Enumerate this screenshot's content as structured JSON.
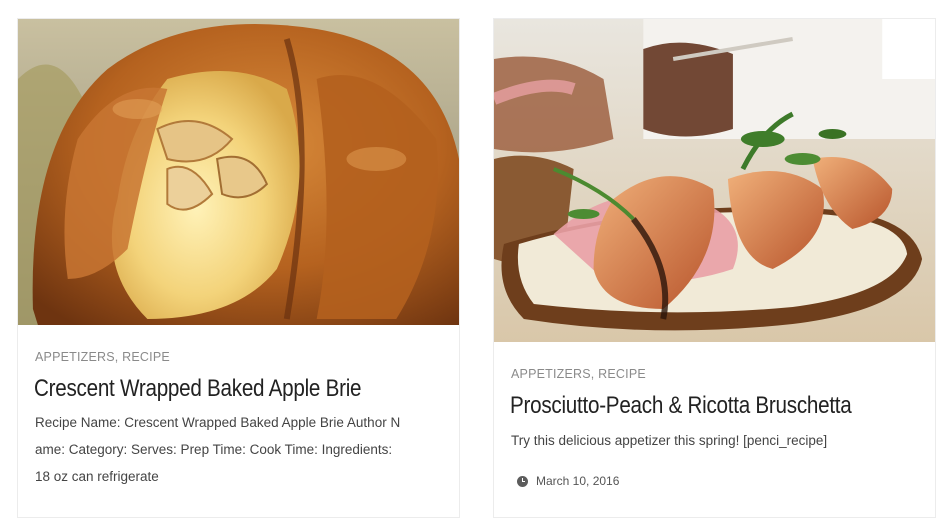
{
  "posts": [
    {
      "image_alt": "Crescent wrapped baked apple brie in golden pastry",
      "categories": [
        "APPETIZERS",
        "RECIPE"
      ],
      "separator": ", ",
      "title": "Crescent Wrapped Baked Apple Brie",
      "excerpt_lines": [
        "Recipe Name: Crescent Wrapped Baked Apple Brie Author N",
        "ame: Category: Serves: Prep Time: Cook Time: Ingredients:",
        "18 oz can refrigerate"
      ]
    },
    {
      "image_alt": "Prosciutto and peach bruschetta with ricotta and arugula",
      "categories": [
        "APPETIZERS",
        "RECIPE"
      ],
      "separator": ", ",
      "title": "Prosciutto-Peach & Ricotta Bruschetta",
      "excerpt": "Try this delicious appetizer this spring! [penci_recipe]",
      "date": "March 10, 2016",
      "date_icon": "clock-icon"
    }
  ]
}
